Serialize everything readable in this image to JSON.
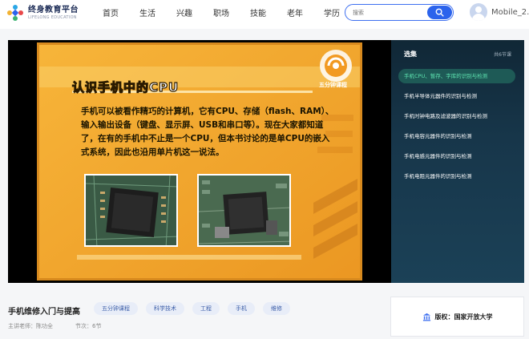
{
  "header": {
    "logo": {
      "title": "终身教育平台",
      "subtitle": "LIFELONG EDUCATION"
    },
    "nav": [
      "首页",
      "生活",
      "兴趣",
      "职场",
      "技能",
      "老年",
      "学历"
    ],
    "search": {
      "placeholder": "搜索"
    },
    "user": {
      "name": "Mobile_2..."
    }
  },
  "player": {
    "slide": {
      "title": "认识手机中的CPU",
      "text": "手机可以被看作精巧的计算机，它有CPU、存储（flash、RAM）、输入输出设备（键盘、显示屏、USB和串口等）。现在大家都知道了，在有的手机中不止是一个CPU，但本书讨论的是单CPU的嵌入式系统，因此也沿用单片机这一说法。",
      "brand": "五分钟课程"
    }
  },
  "playlist": {
    "title": "选集",
    "count": "共6节课",
    "items": [
      {
        "label": "手机CPU、暂存、字库的识别与检测",
        "active": true
      },
      {
        "label": "手机半导体元器件的识别与检测",
        "active": false
      },
      {
        "label": "手机时钟电路及滤波器的识别与检测",
        "active": false
      },
      {
        "label": "手机电容元器件的识别与检测",
        "active": false
      },
      {
        "label": "手机电感元器件的识别与检测",
        "active": false
      },
      {
        "label": "手机电阻元器件的识别与检测",
        "active": false
      }
    ]
  },
  "course": {
    "title": "手机维修入门与提高",
    "tags": [
      "五分钟课程",
      "科学技术",
      "工程",
      "手机",
      "维修"
    ],
    "teacher": "主讲老师：陈功全",
    "lessons": "节次：6节"
  },
  "copyright": {
    "text": "版权：国家开放大学"
  },
  "colors": {
    "accent": "#2b63ec",
    "active_item": "#5fe6b2",
    "sidebar": "#17364a"
  }
}
